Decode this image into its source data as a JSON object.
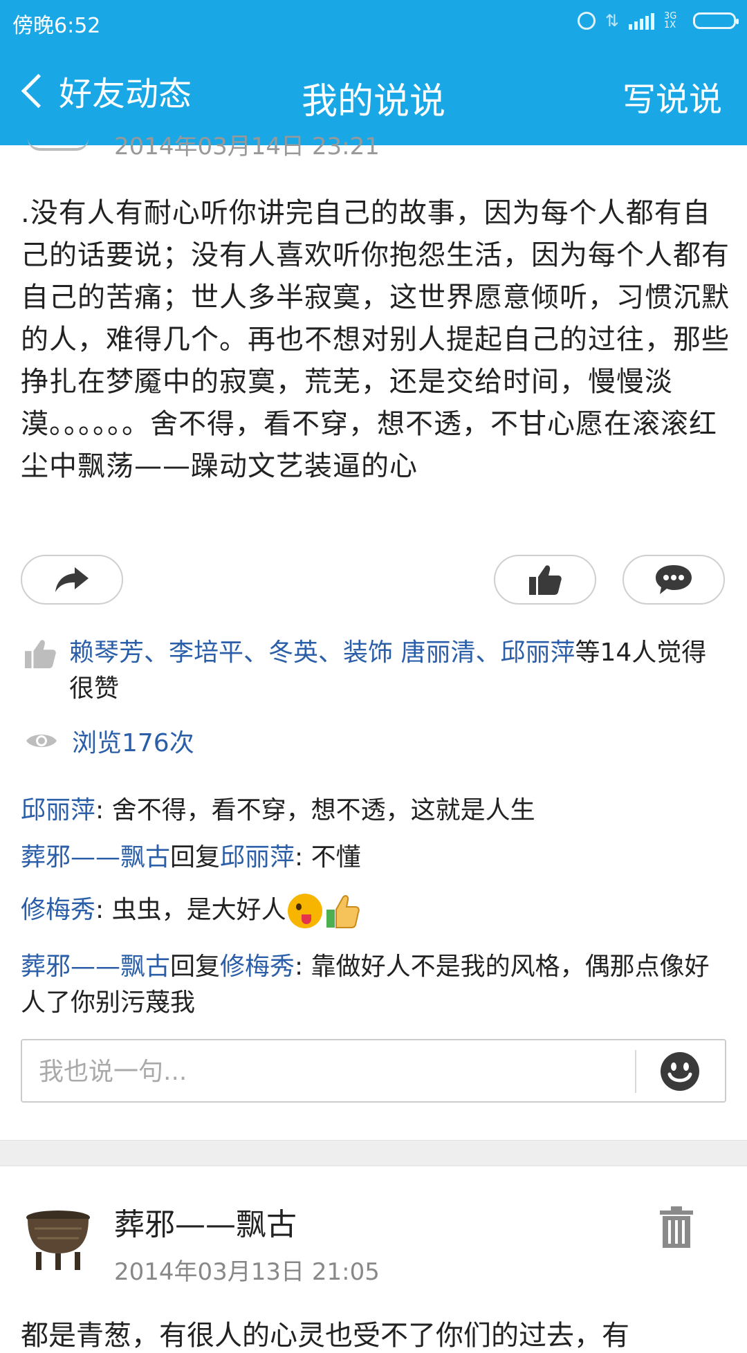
{
  "status_bar": {
    "time": "傍晚6:52",
    "network": "3G 1X"
  },
  "nav": {
    "back_label": "好友动态",
    "title": "我的说说",
    "action_label": "写说说"
  },
  "post1": {
    "time": "2014年03月14日 23:21",
    "content": ".没有人有耐心听你讲完自己的故事，因为每个人都有自己的话要说；没有人喜欢听你抱怨生活，因为每个人都有自己的苦痛；世人多半寂寞，这世界愿意倾听，习惯沉默的人，难得几个。再也不想对别人提起自己的过往，那些挣扎在梦魇中的寂寞，荒芜，还是交给时间，慢慢淡漠。。。。。。舍不得，看不穿，想不透，不甘心愿在滚滚红尘中飘荡——躁动文艺装逼的心",
    "likes": {
      "names": "赖琴芳、李培平、冬英、装饰 唐丽清、邱丽萍",
      "suffix": "等14人觉得很赞"
    },
    "views": "浏览176次",
    "comments": [
      {
        "author": "邱丽萍",
        "sep": ": ",
        "text": "舍不得，看不穿，想不透，这就是人生"
      },
      {
        "author": "葬邪——飘古",
        "reply_word": "回复",
        "reply_to": "邱丽萍",
        "sep": ":  ",
        "text": "不懂"
      },
      {
        "author": "修梅秀",
        "sep": ": ",
        "text": "虫虫，是大好人"
      },
      {
        "author": "葬邪——飘古",
        "reply_word": "回复",
        "reply_to": "修梅秀",
        "sep": ":  ",
        "text": "靠做好人不是我的风格，偶那点像好人了你别污蔑我"
      }
    ],
    "reply_placeholder": "我也说一句..."
  },
  "post2": {
    "author": "葬邪——飘古",
    "time": "2014年03月13日 21:05",
    "preview": "都是青葱，有很人的心灵也受不了你们的过去，有"
  },
  "icons": {
    "back": "chevron-left-icon",
    "share": "share-arrow-icon",
    "like": "thumbs-up-icon",
    "comment": "comment-bubble-icon",
    "views": "eye-icon",
    "emoji": "smiley-icon",
    "delete": "trash-icon"
  },
  "colors": {
    "header_bg": "#1aa7e6",
    "link_blue": "#2a5ea8",
    "muted": "#888888"
  }
}
